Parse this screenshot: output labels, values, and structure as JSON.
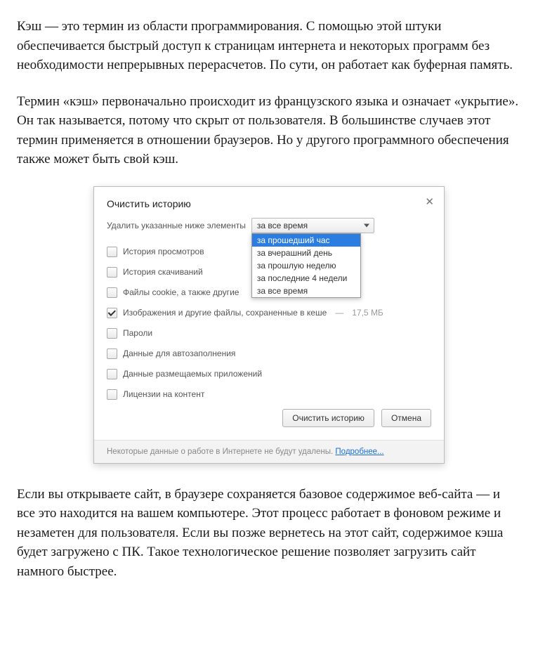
{
  "paragraphs": {
    "p1": "Кэш — это термин из области программирования. С помощью этой штуки обеспечивается быстрый доступ к страницам интернета и некоторых программ без необходимости непрерывных перерасчетов. По сути, он работает как буферная память.",
    "p2": "Термин «кэш» первоначально происходит из французского языка и означает «укрытие». Он так называется, потому что скрыт от пользователя. В большинстве случаев этот термин применяется в отношении браузеров. Но у другого программного обеспечения также может быть свой кэш.",
    "p3": "Если вы открываете сайт, в браузере сохраняется базовое содержимое веб-сайта — и все это находится на вашем компьютере. Этот процесс работает в фоновом режиме и незаметен для пользователя. Если вы позже вернетесь на этот сайт, содержимое кэша будет загружено с ПК. Такое технологическое решение позволяет загрузить сайт намного быстрее."
  },
  "dialog": {
    "title": "Очистить историю",
    "close_glyph": "✕",
    "prompt": "Удалить указанные ниже элементы",
    "select_value": "за все время",
    "options": [
      "за прошедший час",
      "за вчерашний день",
      "за прошлую неделю",
      "за последние 4 недели",
      "за все время"
    ],
    "items": [
      {
        "label": "История просмотров",
        "checked": false
      },
      {
        "label": "История скачиваний",
        "checked": false
      },
      {
        "label": "Файлы cookie, а также другие",
        "checked": false
      },
      {
        "label": "Изображения и другие файлы, сохраненные в кеше",
        "checked": true,
        "size": "17,5 МБ"
      },
      {
        "label": "Пароли",
        "checked": false
      },
      {
        "label": "Данные для автозаполнения",
        "checked": false
      },
      {
        "label": "Данные размещаемых приложений",
        "checked": false
      },
      {
        "label": "Лицензии на контент",
        "checked": false
      }
    ],
    "buttons": {
      "primary": "Очистить историю",
      "cancel": "Отмена"
    },
    "footer_text": "Некоторые данные о работе в Интернете не будут удалены. ",
    "footer_link": "Подробнее..."
  }
}
